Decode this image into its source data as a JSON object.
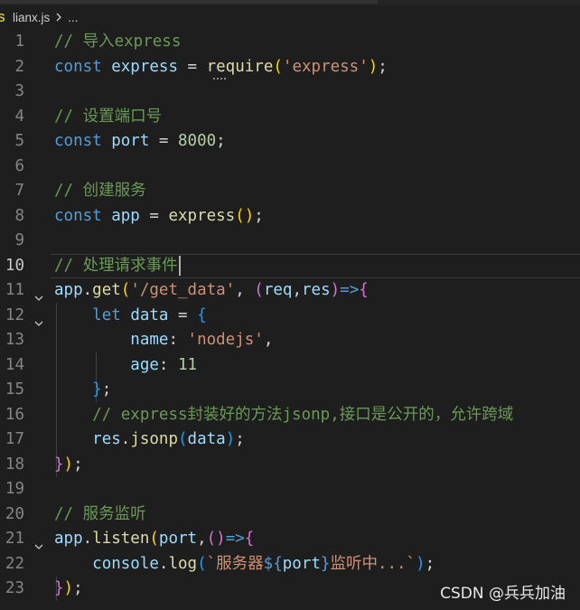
{
  "breadcrumb": {
    "file_icon_text": "S",
    "filename": "lianx.js",
    "ellipsis": "..."
  },
  "current_line": 10,
  "watermark": "CSDN @兵兵加油",
  "colors": {
    "background": "#1e1e1e",
    "comment": "#6a9955",
    "keyword": "#569cd6",
    "variable": "#9cdcfe",
    "function": "#dcdcaa",
    "string": "#ce9178",
    "number": "#b5cea8",
    "bracket_1": "#ffd700",
    "bracket_2": "#da70d6",
    "bracket_3": "#179fff"
  },
  "lines": [
    {
      "n": "1",
      "t": [
        [
          "c",
          "// 导入express"
        ]
      ]
    },
    {
      "n": "2",
      "t": [
        [
          "k",
          "const"
        ],
        [
          "p",
          " "
        ],
        [
          "v",
          "express"
        ],
        [
          "p",
          " = "
        ],
        [
          "f",
          "require"
        ],
        [
          "b1",
          "("
        ],
        [
          "s",
          "'express'"
        ],
        [
          "b1",
          ")"
        ],
        [
          "p",
          ";"
        ]
      ]
    },
    {
      "n": "3",
      "t": []
    },
    {
      "n": "4",
      "t": [
        [
          "c",
          "// 设置端口号"
        ]
      ]
    },
    {
      "n": "5",
      "t": [
        [
          "k",
          "const"
        ],
        [
          "p",
          " "
        ],
        [
          "v",
          "port"
        ],
        [
          "p",
          " = "
        ],
        [
          "n",
          "8000"
        ],
        [
          "p",
          ";"
        ]
      ]
    },
    {
      "n": "6",
      "t": []
    },
    {
      "n": "7",
      "t": [
        [
          "c",
          "// 创建服务"
        ]
      ]
    },
    {
      "n": "8",
      "t": [
        [
          "k",
          "const"
        ],
        [
          "p",
          " "
        ],
        [
          "v",
          "app"
        ],
        [
          "p",
          " = "
        ],
        [
          "f",
          "express"
        ],
        [
          "b1",
          "()"
        ],
        [
          "p",
          ";"
        ]
      ]
    },
    {
      "n": "9",
      "t": []
    },
    {
      "n": "10",
      "t": [
        [
          "c",
          "// 处理请求事件"
        ]
      ]
    },
    {
      "n": "11",
      "fold": true,
      "t": [
        [
          "v",
          "app"
        ],
        [
          "p",
          "."
        ],
        [
          "f",
          "get"
        ],
        [
          "b1",
          "("
        ],
        [
          "s",
          "'/get_data'"
        ],
        [
          "p",
          ", "
        ],
        [
          "b2",
          "("
        ],
        [
          "v",
          "req"
        ],
        [
          "p",
          ","
        ],
        [
          "v",
          "res"
        ],
        [
          "b2",
          ")"
        ],
        [
          "k",
          "=>"
        ],
        [
          "b2",
          "{"
        ]
      ]
    },
    {
      "n": "12",
      "fold": true,
      "t": [
        [
          "p",
          "    "
        ],
        [
          "k",
          "let"
        ],
        [
          "p",
          " "
        ],
        [
          "v",
          "data"
        ],
        [
          "p",
          " = "
        ],
        [
          "b3",
          "{"
        ]
      ]
    },
    {
      "n": "13",
      "t": [
        [
          "p",
          "        "
        ],
        [
          "v",
          "name"
        ],
        [
          "p",
          ": "
        ],
        [
          "s",
          "'nodejs'"
        ],
        [
          "p",
          ","
        ]
      ]
    },
    {
      "n": "14",
      "t": [
        [
          "p",
          "        "
        ],
        [
          "v",
          "age"
        ],
        [
          "p",
          ": "
        ],
        [
          "n",
          "11"
        ]
      ]
    },
    {
      "n": "15",
      "t": [
        [
          "p",
          "    "
        ],
        [
          "b3",
          "}"
        ],
        [
          "p",
          ";"
        ]
      ]
    },
    {
      "n": "16",
      "t": [
        [
          "p",
          "    "
        ],
        [
          "c",
          "// express封装好的方法jsonp,接口是公开的，允许跨域"
        ]
      ]
    },
    {
      "n": "17",
      "t": [
        [
          "p",
          "    "
        ],
        [
          "v",
          "res"
        ],
        [
          "p",
          "."
        ],
        [
          "f",
          "jsonp"
        ],
        [
          "b3",
          "("
        ],
        [
          "v",
          "data"
        ],
        [
          "b3",
          ")"
        ],
        [
          "p",
          ";"
        ]
      ]
    },
    {
      "n": "18",
      "t": [
        [
          "b2",
          "}"
        ],
        [
          "b1",
          ")"
        ],
        [
          "p",
          ";"
        ]
      ]
    },
    {
      "n": "19",
      "t": []
    },
    {
      "n": "20",
      "t": [
        [
          "c",
          "// 服务监听"
        ]
      ]
    },
    {
      "n": "21",
      "fold": true,
      "t": [
        [
          "v",
          "app"
        ],
        [
          "p",
          "."
        ],
        [
          "f",
          "listen"
        ],
        [
          "b1",
          "("
        ],
        [
          "v",
          "port"
        ],
        [
          "p",
          ","
        ],
        [
          "b2",
          "()"
        ],
        [
          "k",
          "=>"
        ],
        [
          "b2",
          "{"
        ]
      ]
    },
    {
      "n": "22",
      "t": [
        [
          "p",
          "    "
        ],
        [
          "v",
          "console"
        ],
        [
          "p",
          "."
        ],
        [
          "f",
          "log"
        ],
        [
          "b3",
          "("
        ],
        [
          "s",
          "`服务器"
        ],
        [
          "k",
          "${"
        ],
        [
          "v",
          "port"
        ],
        [
          "k",
          "}"
        ],
        [
          "s",
          "监听中...`"
        ],
        [
          "b3",
          ")"
        ],
        [
          "p",
          ";"
        ]
      ]
    },
    {
      "n": "23",
      "t": [
        [
          "b2",
          "}"
        ],
        [
          "b1",
          ")"
        ],
        [
          "p",
          ";"
        ]
      ]
    }
  ]
}
